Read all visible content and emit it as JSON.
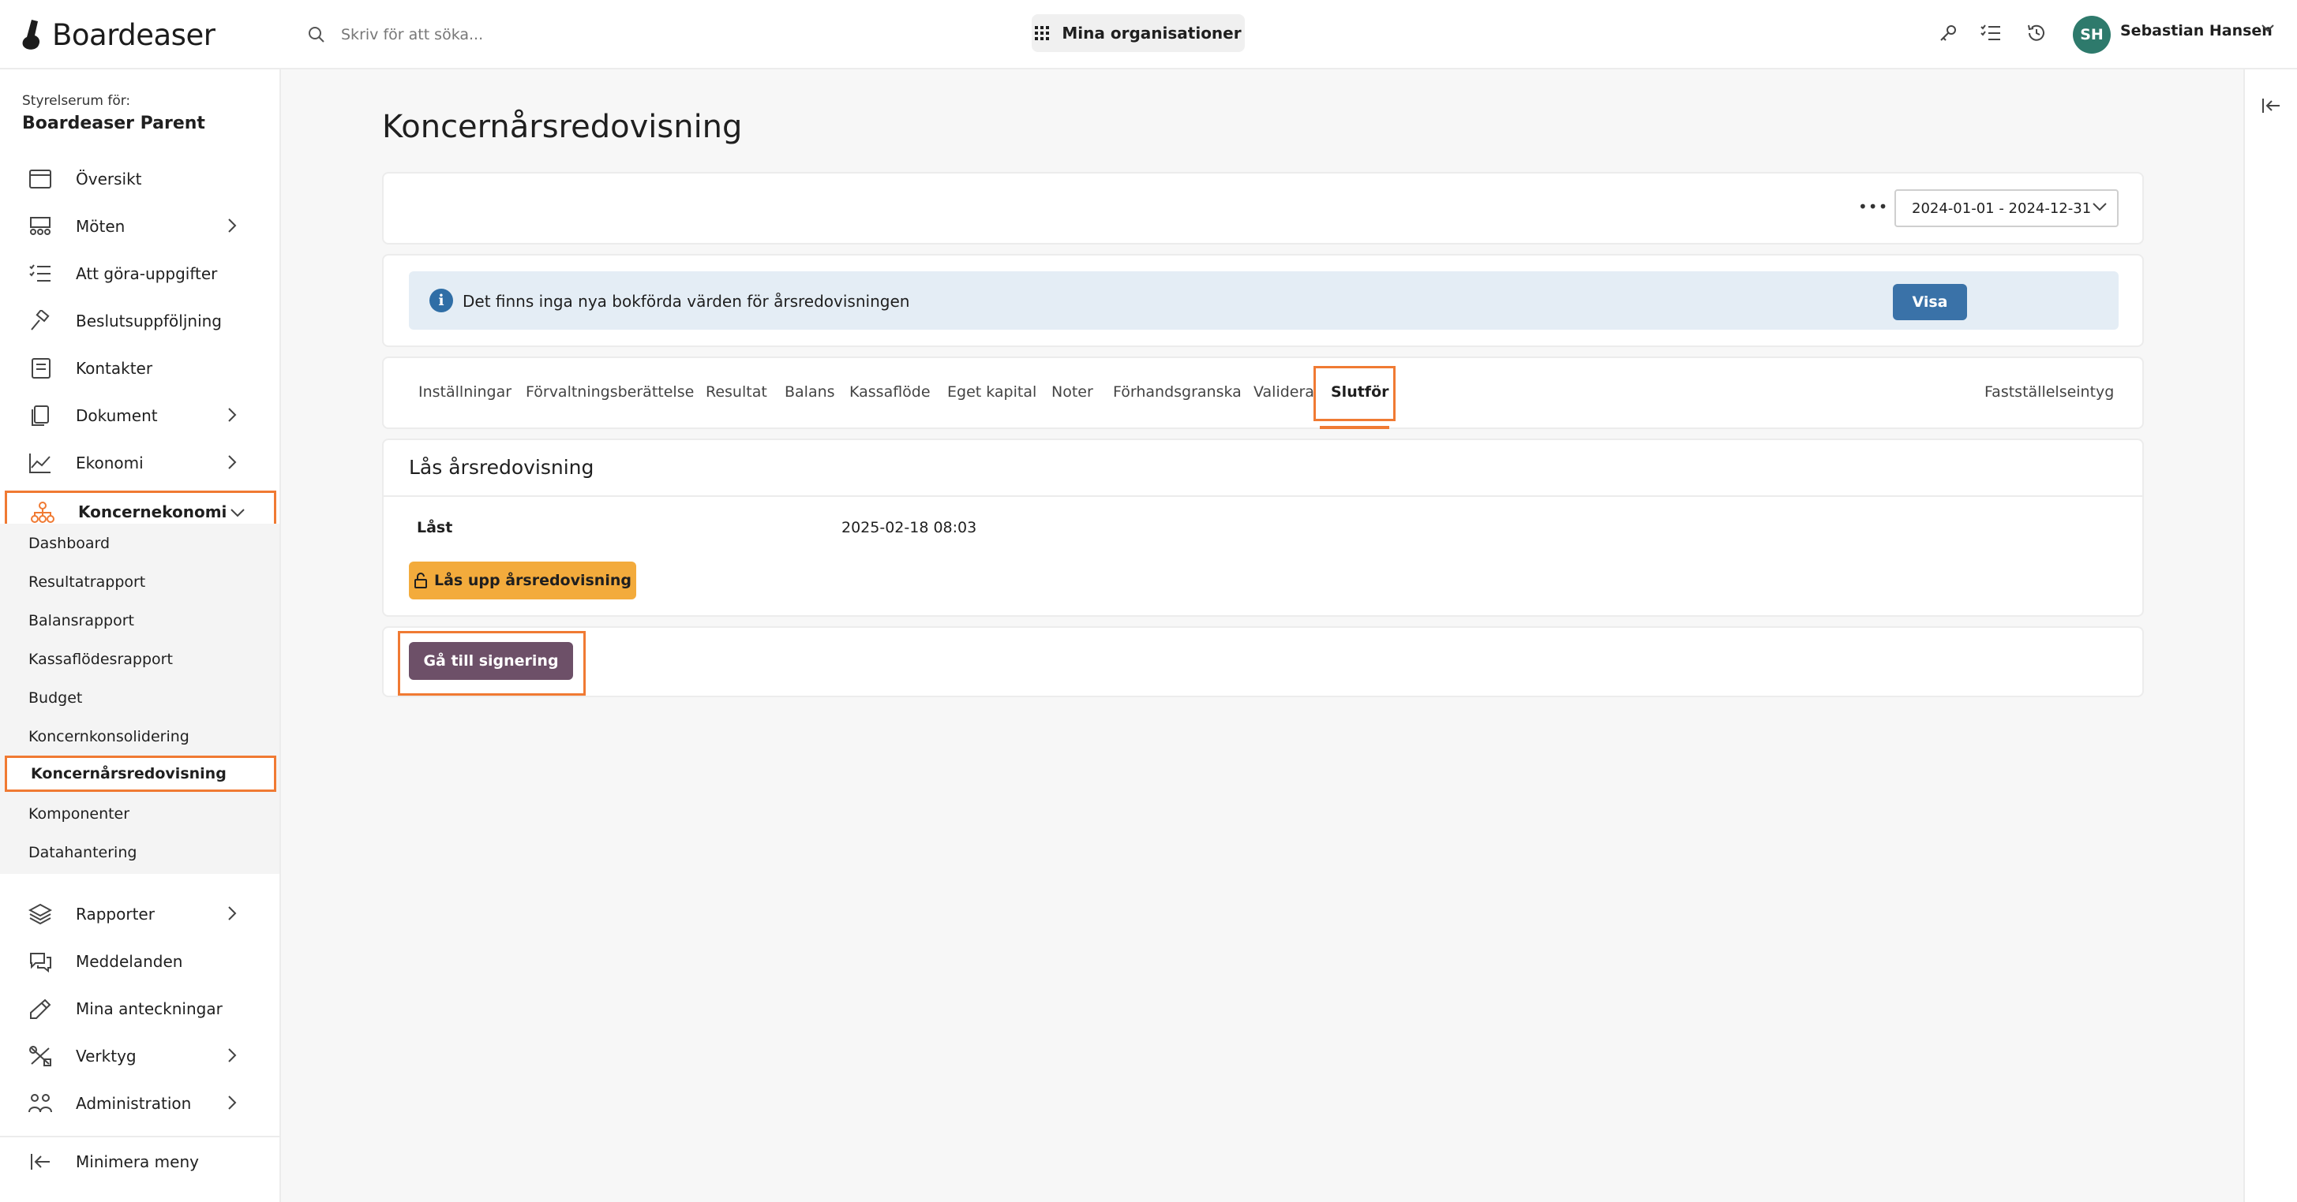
{
  "app": {
    "brand": "Boardeaser"
  },
  "header": {
    "search_placeholder": "Skriv för att söka...",
    "org_button_label": "Mina organisationer",
    "user_initials": "SH",
    "user_name": "Sebastian Hansen"
  },
  "sidebar": {
    "caption": "Styrelserum för:",
    "org_name": "Boardeaser Parent",
    "items": [
      {
        "label": "Översikt",
        "icon": "calendar-icon"
      },
      {
        "label": "Möten",
        "icon": "meeting-icon"
      },
      {
        "label": "Att göra-uppgifter",
        "icon": "checklist-icon"
      },
      {
        "label": "Beslutsuppföljning",
        "icon": "gavel-icon"
      },
      {
        "label": "Kontakter",
        "icon": "contacts-icon"
      },
      {
        "label": "Dokument",
        "icon": "document-icon"
      },
      {
        "label": "Ekonomi",
        "icon": "chart-line-icon"
      },
      {
        "label": "Koncernekonomi",
        "icon": "org-tree-icon"
      }
    ],
    "sub_items": [
      "Dashboard",
      "Resultatrapport",
      "Balansrapport",
      "Kassaflödesrapport",
      "Budget",
      "Koncernkonsolidering",
      "Koncernårsredovisning",
      "Komponenter",
      "Datahantering"
    ],
    "lower_items": [
      {
        "label": "Rapporter",
        "icon": "layers-icon"
      },
      {
        "label": "Meddelanden",
        "icon": "chat-icon"
      },
      {
        "label": "Mina anteckningar",
        "icon": "pencil-icon"
      },
      {
        "label": "Verktyg",
        "icon": "tools-icon"
      },
      {
        "label": "Administration",
        "icon": "users-icon"
      }
    ],
    "collapse_label": "Minimera meny"
  },
  "main": {
    "title": "Koncernårsredovisning",
    "period": "2024-01-01 - 2024-12-31",
    "info_text": "Det finns inga nya bokförda värden för årsredovisningen",
    "info_button": "Visa",
    "tabs": [
      "Inställningar",
      "Förvaltningsberättelse",
      "Resultat",
      "Balans",
      "Kassaflöde",
      "Eget kapital",
      "Noter",
      "Förhandsgranska",
      "Validera",
      "Slutför"
    ],
    "active_tab": "Slutför",
    "right_tab": "Fastställelseintyg",
    "lock_section": {
      "title": "Lås årsredovisning",
      "label": "Låst",
      "date": "2025-02-18 08:03",
      "unlock_button": "Lås upp årsredovisning"
    },
    "sign_button": "Gå till signering"
  },
  "colors": {
    "accent_highlight": "#f07a33",
    "info_button": "#3a72a8",
    "unlock_button": "#f3ab3c",
    "sign_button": "#6d5068",
    "avatar": "#2e7a6c"
  }
}
